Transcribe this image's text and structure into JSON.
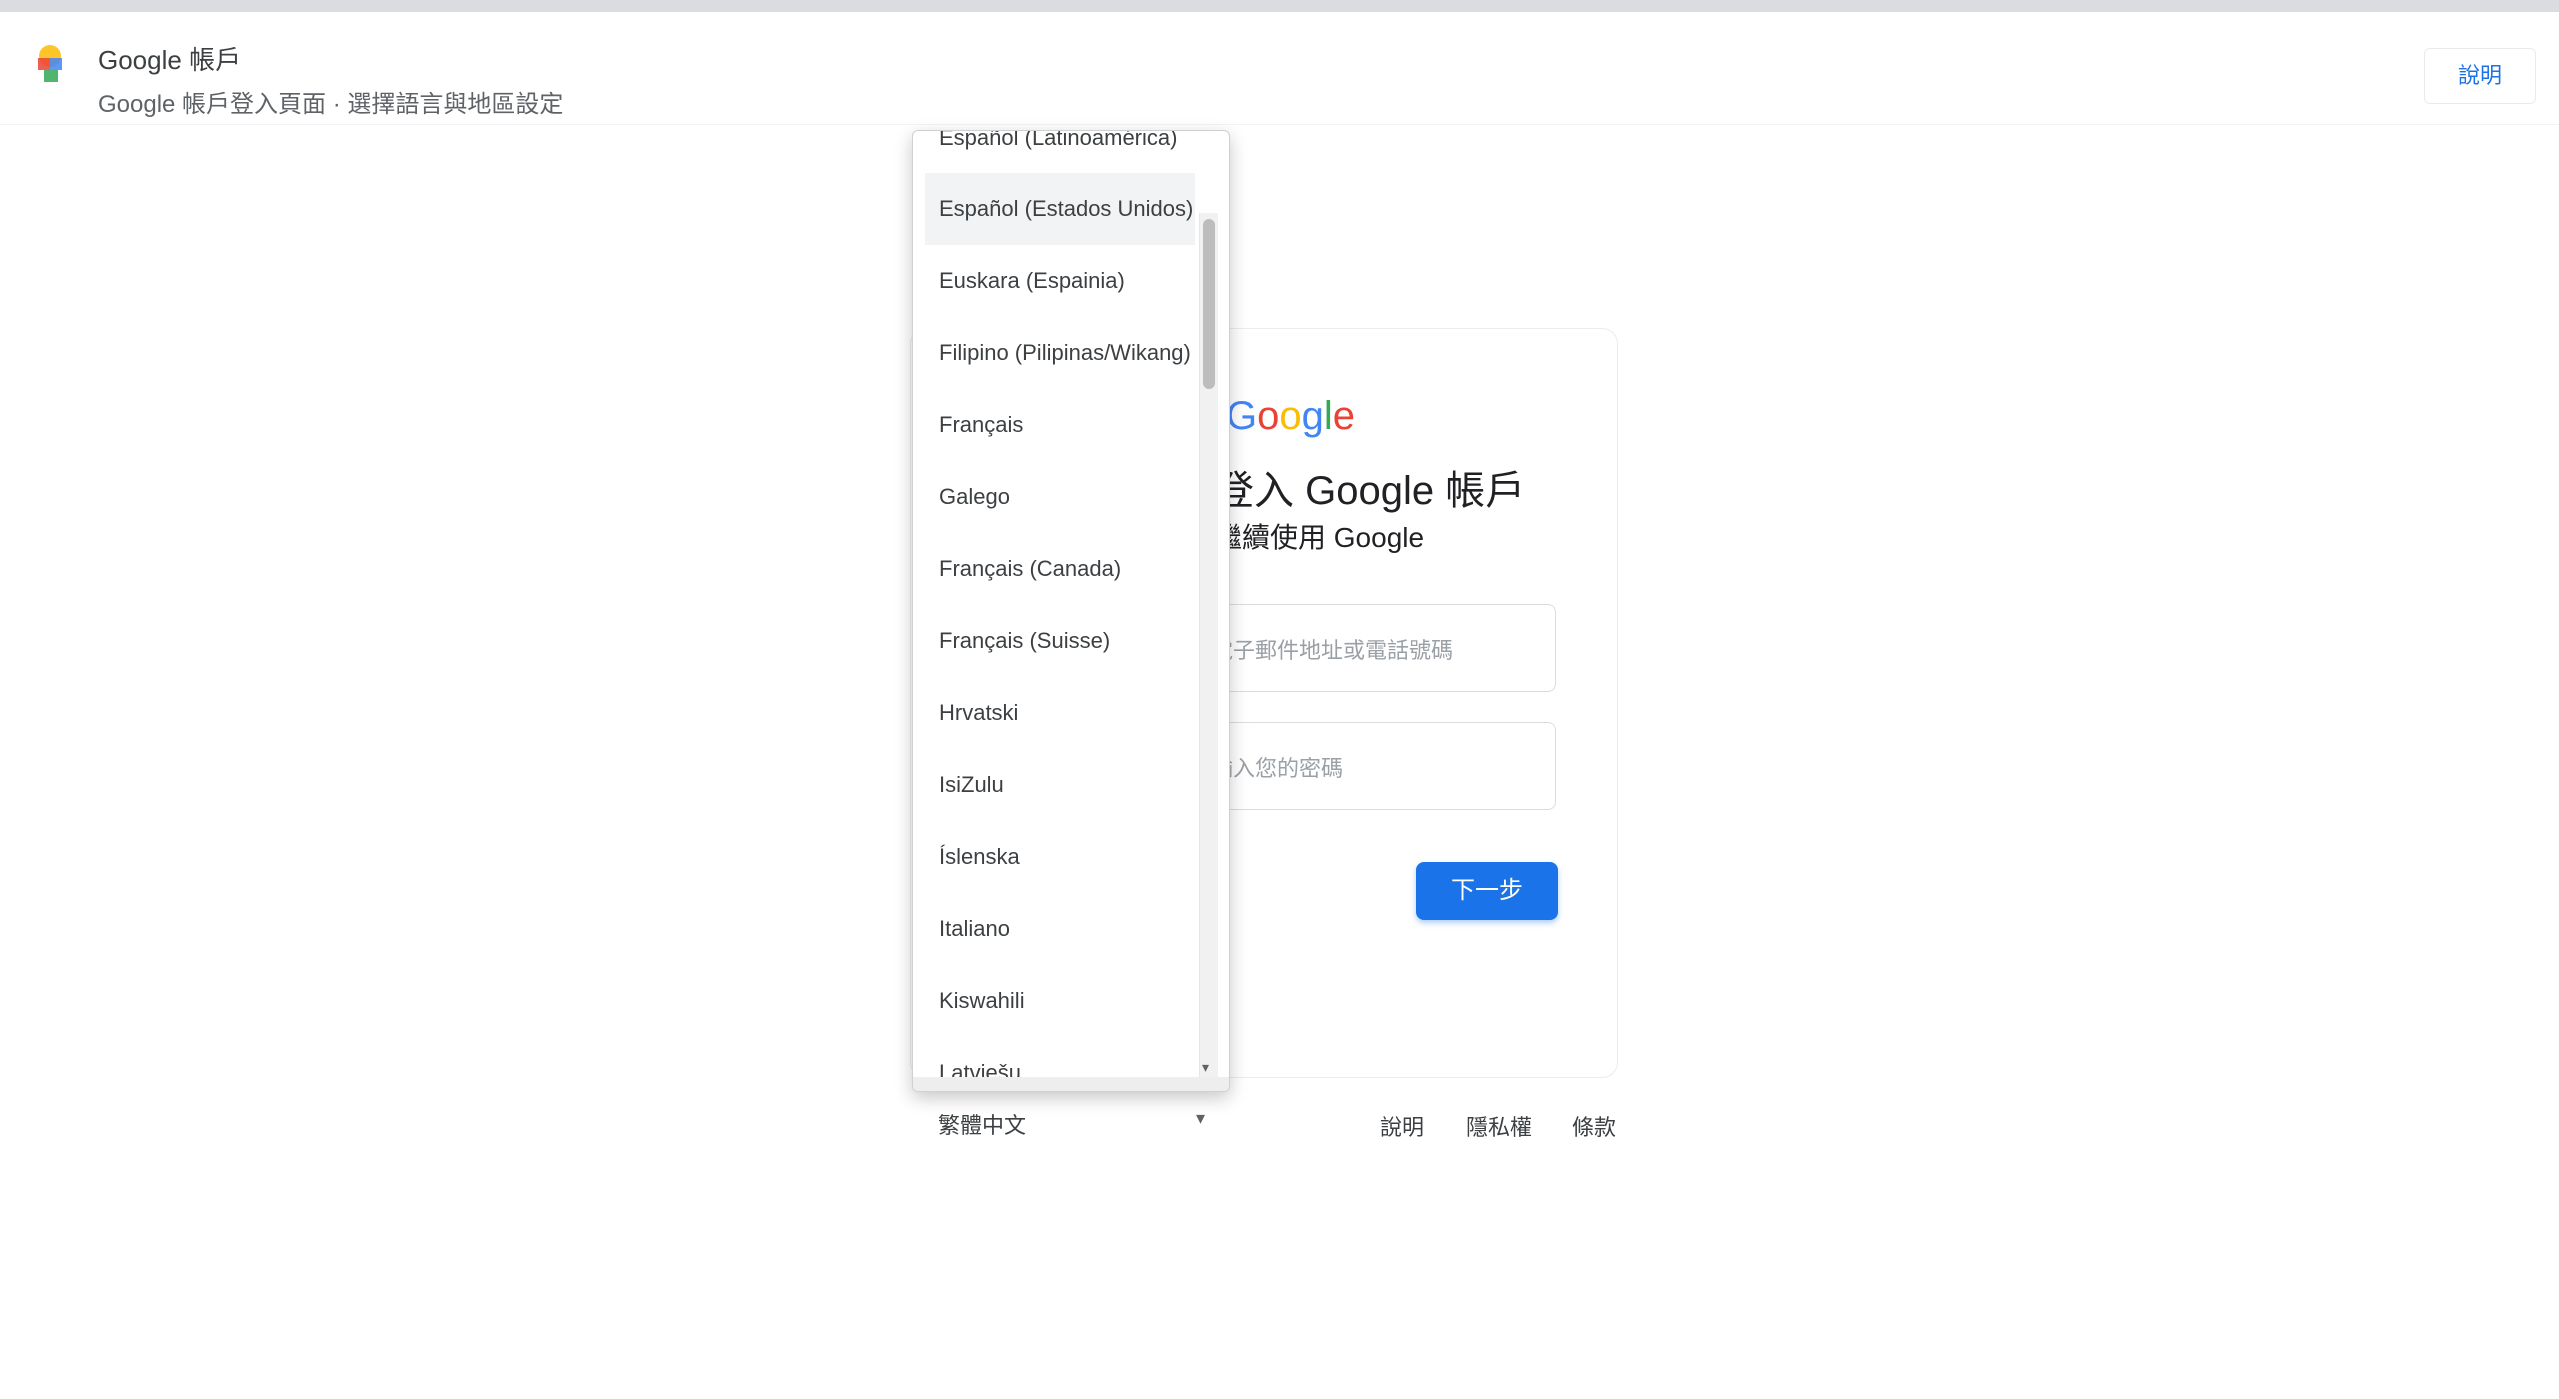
{
  "header": {
    "app_name": "Google 帳戶",
    "subtitle": "Google 帳戶登入頁面 · 選擇語言與地區設定",
    "action_label": "說明"
  },
  "signin": {
    "title": "登入 Google 帳戶",
    "subtitle": "繼續使用 Google",
    "email_placeholder": "電子郵件地址或電話號碼",
    "password_placeholder": "輸入您的密碼",
    "next_label": "下一步"
  },
  "language_menu": {
    "items": [
      "Español (Latinoamérica)",
      "Español (Estados Unidos)",
      "Euskara (Espainia)",
      "Filipino (Pilipinas/Wikang)",
      "Français",
      "Galego",
      "Français (Canada)",
      "Français (Suisse)",
      "Hrvatski",
      "IsiZulu",
      "Íslenska",
      "Italiano",
      "Kiswahili",
      "Latviešu"
    ],
    "selected_index": 1
  },
  "footer": {
    "language": "繁體中文",
    "links": [
      "說明",
      "隱私權",
      "條款"
    ]
  },
  "colors": {
    "primary": "#1a73e8",
    "google_blue": "#4285f4",
    "google_red": "#ea4335",
    "google_yellow": "#fbbc05",
    "google_green": "#34a853"
  }
}
